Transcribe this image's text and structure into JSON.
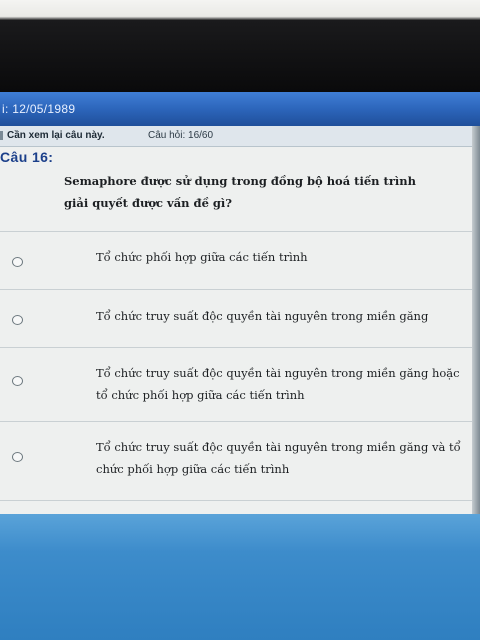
{
  "window": {
    "title": "i: 12/05/1989"
  },
  "info_bar": {
    "review_label": "Cần xem lại câu này.",
    "question_count": "Câu hỏi: 16/60"
  },
  "question": {
    "header": "Câu 16:",
    "text": "Semaphore được sử dụng trong đồng bộ hoá tiến trình giải quyết được vấn đề gì?"
  },
  "options": [
    {
      "label": "Tổ chức phối hợp giữa các tiến trình"
    },
    {
      "label": "Tổ chức truy suất độc quyền tài nguyên trong miền găng"
    },
    {
      "label": "Tổ chức truy suất độc quyền tài nguyên trong miền găng hoặc tổ chức phối hợp giữa các tiến trình"
    },
    {
      "label": "Tổ chức truy suất độc quyền tài nguyên trong miền găng và tổ chức phối hợp giữa các tiến trình"
    }
  ],
  "colors": {
    "title_bar": "#2b63b8",
    "question_header": "#1b3f8a",
    "taskbar": "#3d8ccb"
  }
}
